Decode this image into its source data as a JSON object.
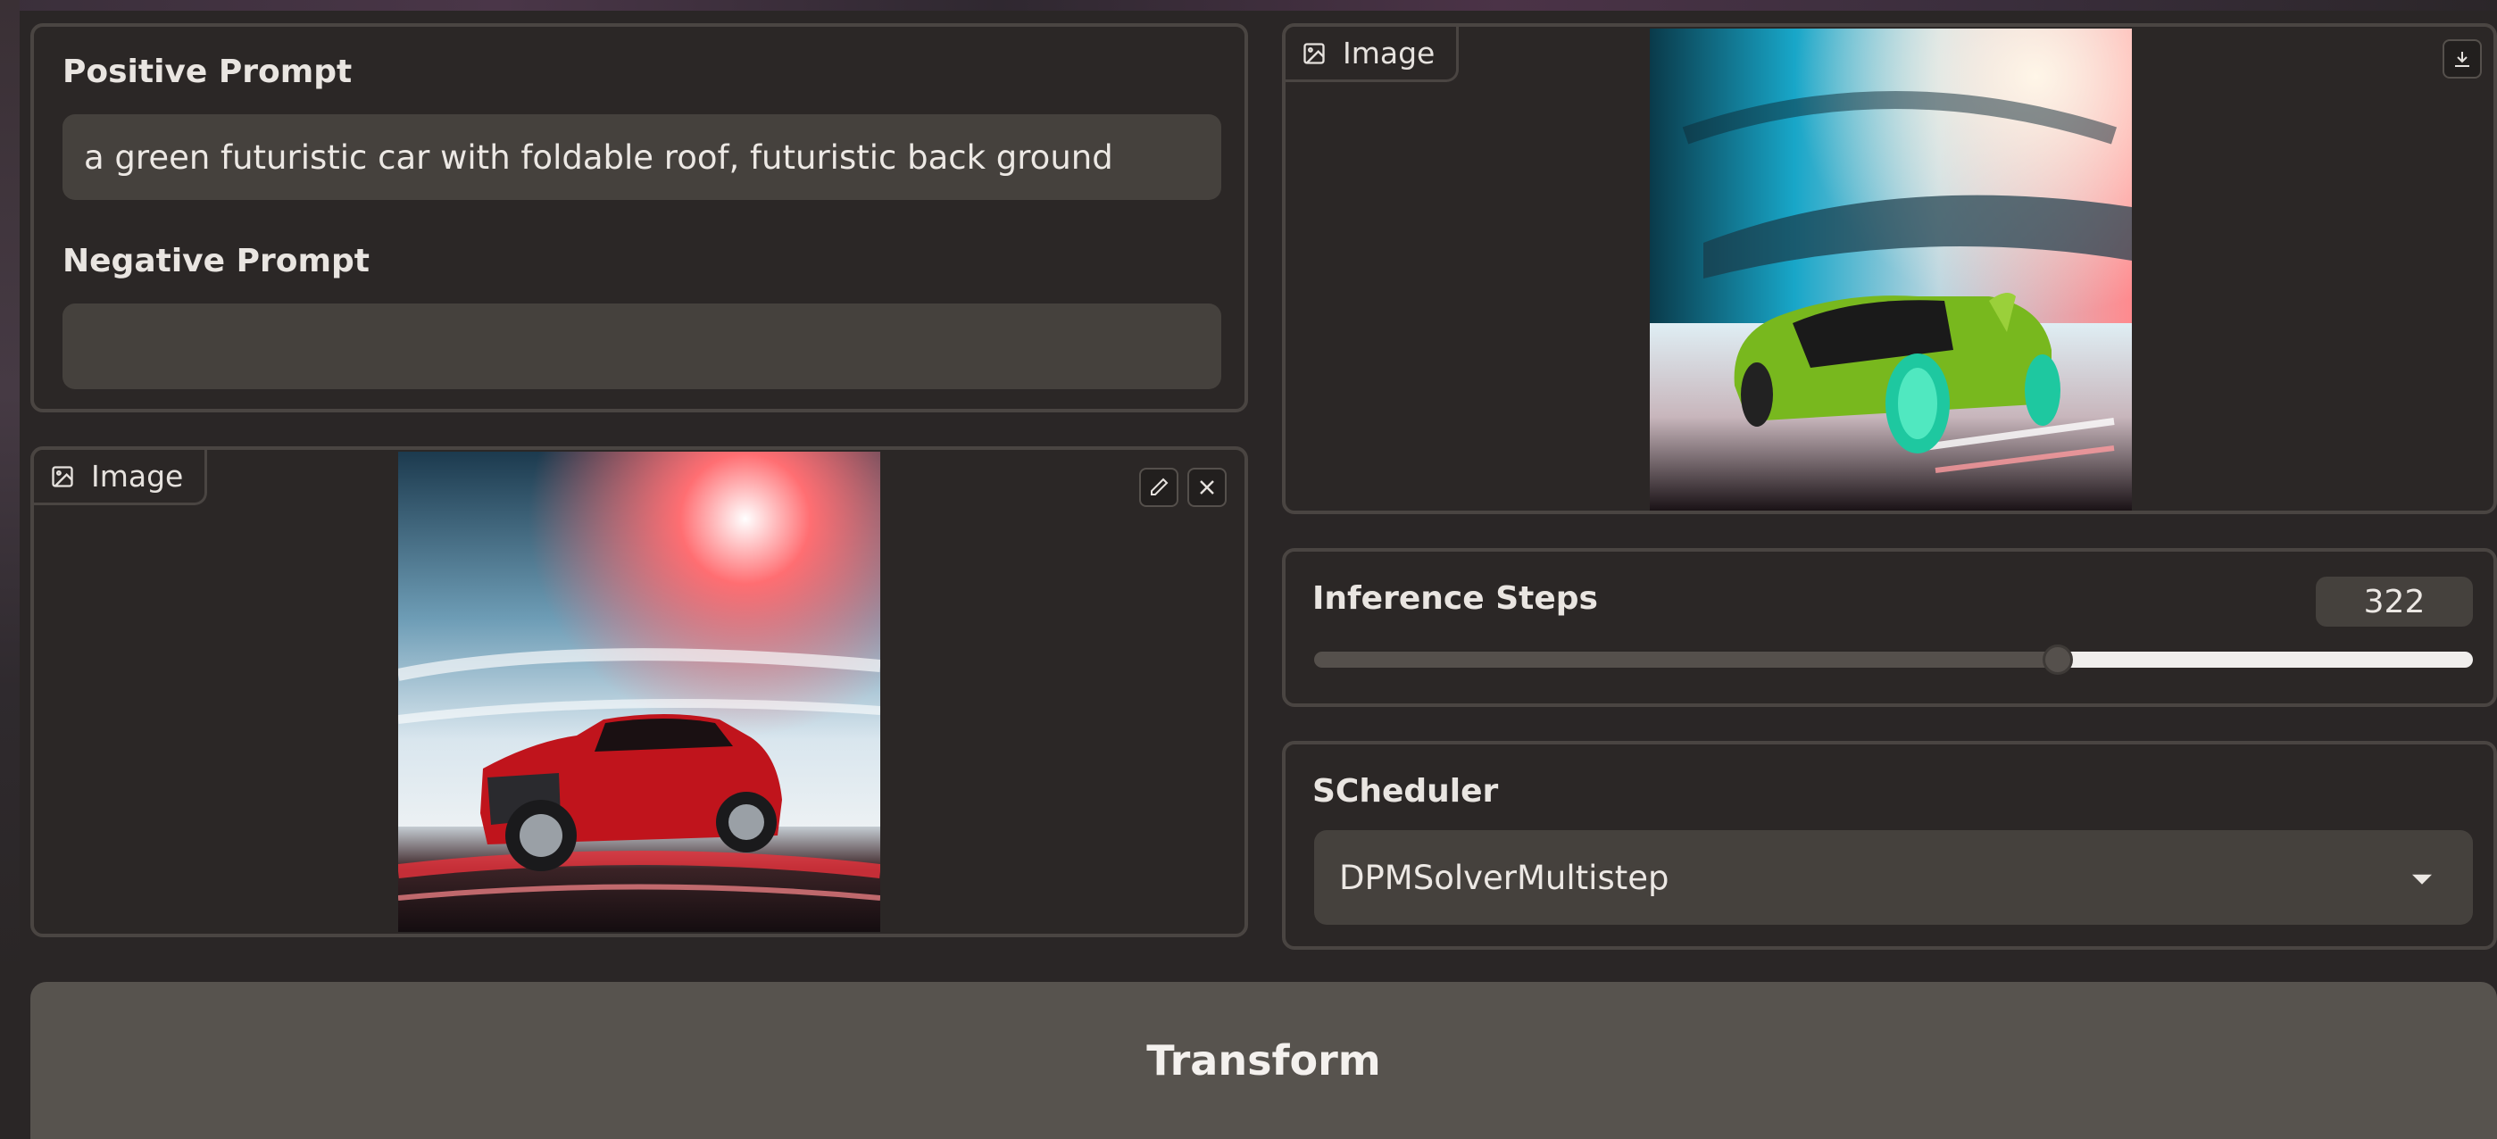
{
  "positive_prompt": {
    "label": "Positive Prompt",
    "value": "a green futuristic car with foldable roof, futuristic back ground"
  },
  "negative_prompt": {
    "label": "Negative Prompt",
    "value": ""
  },
  "input_image": {
    "label": "Image",
    "icons": [
      "image-icon",
      "pencil-icon",
      "close-icon"
    ]
  },
  "output_image": {
    "label": "Image",
    "icons": [
      "image-icon",
      "download-icon"
    ]
  },
  "inference_steps": {
    "label": "Inference Steps",
    "value": "322",
    "fraction": 0.64
  },
  "scheduler": {
    "label": "SCheduler",
    "selected": "DPMSolverMultistep"
  },
  "transform_button": {
    "label": "Transform"
  },
  "colors": {
    "background": "#2a2626",
    "panel_border": "#4a4542",
    "input_fill": "#45413d",
    "button_fill": "#57534e"
  }
}
